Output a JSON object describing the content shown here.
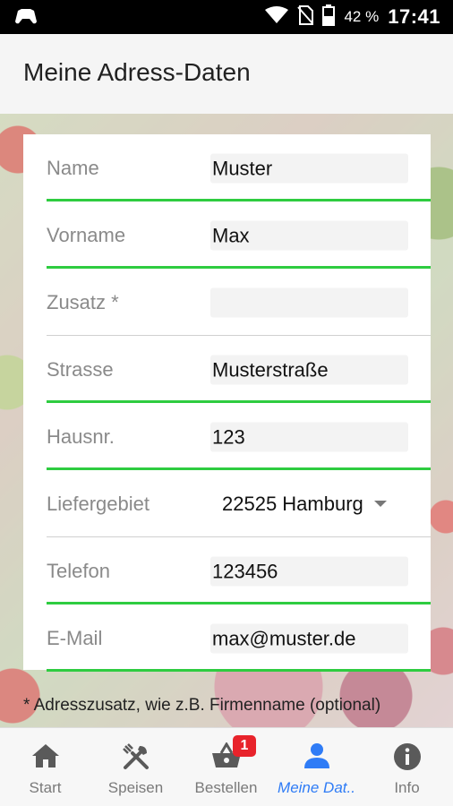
{
  "statusbar": {
    "battery_pct": "42 %",
    "time": "17:41"
  },
  "header": {
    "title": "Meine Adress-Daten"
  },
  "form": {
    "fields": [
      {
        "label": "Name",
        "value": "Muster"
      },
      {
        "label": "Vorname",
        "value": "Max"
      },
      {
        "label": "Zusatz *",
        "value": ""
      },
      {
        "label": "Strasse",
        "value": "Musterstraße"
      },
      {
        "label": "Hausnr.",
        "value": "123"
      },
      {
        "label": "Liefergebiet",
        "value": "22525 Hamburg"
      },
      {
        "label": "Telefon",
        "value": "123456"
      },
      {
        "label": "E-Mail",
        "value": "max@muster.de"
      }
    ],
    "footnote": "* Adresszusatz, wie z.B. Firmenname (optional)"
  },
  "tabs": [
    {
      "label": "Start",
      "icon": "home-icon"
    },
    {
      "label": "Speisen",
      "icon": "fork-knife-icon"
    },
    {
      "label": "Bestellen",
      "icon": "basket-icon",
      "badge": "1"
    },
    {
      "label": "Μeine Dat..",
      "icon": "person-icon",
      "active": true
    },
    {
      "label": "Info",
      "icon": "info-icon"
    }
  ],
  "colors": {
    "accent_green": "#2ecc40",
    "active_blue": "#2f7cf6",
    "badge_red": "#e8232b"
  }
}
